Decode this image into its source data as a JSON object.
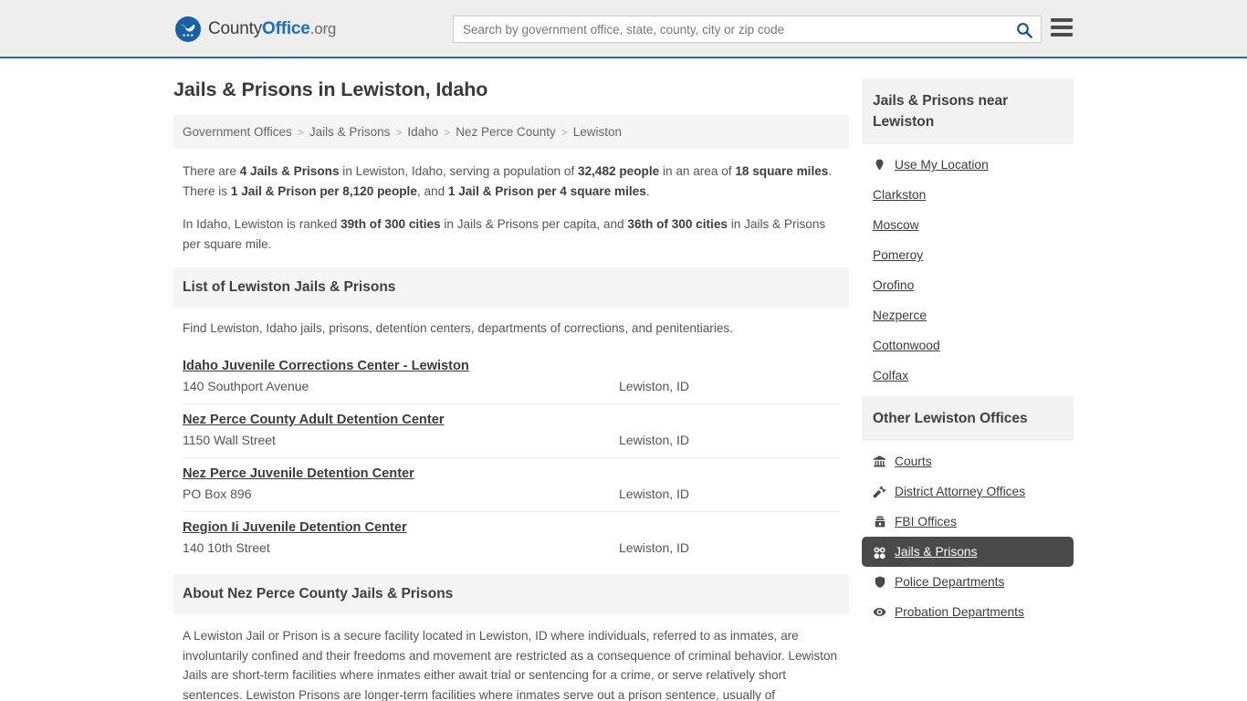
{
  "header": {
    "brand": {
      "part1": "County",
      "part2": "Office",
      "part3": ".org",
      "logo_icon": "eagle-stars-logo-icon"
    },
    "search": {
      "placeholder": "Search by government office, state, county, city or zip code",
      "value": "",
      "icon": "search-icon"
    },
    "menu_icon": "hamburger-menu-icon"
  },
  "main": {
    "title": "Jails & Prisons in Lewiston, Idaho",
    "breadcrumb": [
      "Government Offices",
      "Jails & Prisons",
      "Idaho",
      "Nez Perce County",
      "Lewiston"
    ],
    "breadcrumb_separator": ">",
    "intro_paragraph_1": "There are 4 Jails & Prisons in Lewiston, Idaho, serving a population of 32,482 people in an area of 18 square miles. There is 1 Jail & Prison per 8,120 people, and 1 Jail & Prison per 4 square miles.",
    "intro_paragraph_2": "In Idaho, Lewiston is ranked 39th of 300 cities in Jails & Prisons per capita, and 36th of 300 cities in Jails & Prisons per square mile.",
    "list_section": {
      "heading": "List of Lewiston Jails & Prisons",
      "lead": "Find Lewiston, Idaho jails, prisons, detention centers, departments of corrections, and penitentiaries.",
      "items": [
        {
          "name": "Idaho Juvenile Corrections Center - Lewiston",
          "address": "140 Southport Avenue",
          "city": "Lewiston, ID"
        },
        {
          "name": "Nez Perce County Adult Detention Center",
          "address": "1150 Wall Street",
          "city": "Lewiston, ID"
        },
        {
          "name": "Nez Perce Juvenile Detention Center",
          "address": "PO Box 896",
          "city": "Lewiston, ID"
        },
        {
          "name": "Region Ii Juvenile Detention Center",
          "address": "140 10th Street",
          "city": "Lewiston, ID"
        }
      ]
    },
    "about_section": {
      "heading": "About Nez Perce County Jails & Prisons",
      "body": "A Lewiston Jail or Prison is a secure facility located in Lewiston, ID where individuals, referred to as inmates, are involuntarily confined and their freedoms and movement are restricted as a consequence of criminal behavior. Lewiston Jails are short-term facilities where inmates either await trial or sentencing for a crime, or serve relatively short sentences. Lewiston Prisons are longer-term facilities where inmates serve out a prison sentence, usually of"
    }
  },
  "sidebar": {
    "nearby": {
      "heading": "Jails & Prisons near Lewiston",
      "items": [
        {
          "label": "Use My Location",
          "icon": "map-pin-icon"
        },
        {
          "label": "Clarkston",
          "icon": ""
        },
        {
          "label": "Moscow",
          "icon": ""
        },
        {
          "label": "Pomeroy",
          "icon": ""
        },
        {
          "label": "Orofino",
          "icon": ""
        },
        {
          "label": "Nezperce",
          "icon": ""
        },
        {
          "label": "Cottonwood",
          "icon": ""
        },
        {
          "label": "Colfax",
          "icon": ""
        }
      ]
    },
    "other_offices": {
      "heading": "Other Lewiston Offices",
      "items": [
        {
          "label": "Courts",
          "icon": "bank-columns-icon",
          "active": false
        },
        {
          "label": "District Attorney Offices",
          "icon": "gavel-icon",
          "active": false
        },
        {
          "label": "FBI Offices",
          "icon": "fbi-badge-icon",
          "active": false
        },
        {
          "label": "Jails & Prisons",
          "icon": "handcuffs-icon",
          "active": true
        },
        {
          "label": "Police Departments",
          "icon": "shield-icon",
          "active": false
        },
        {
          "label": "Probation Departments",
          "icon": "eye-icon",
          "active": false
        }
      ]
    }
  },
  "colors": {
    "header_bg": "#eeeeee",
    "header_border": "#2a6aad",
    "brand_blue": "#1a6fc4",
    "section_bg": "#f5f5f5",
    "active_bg": "#4a4a4a",
    "text": "#555555"
  }
}
